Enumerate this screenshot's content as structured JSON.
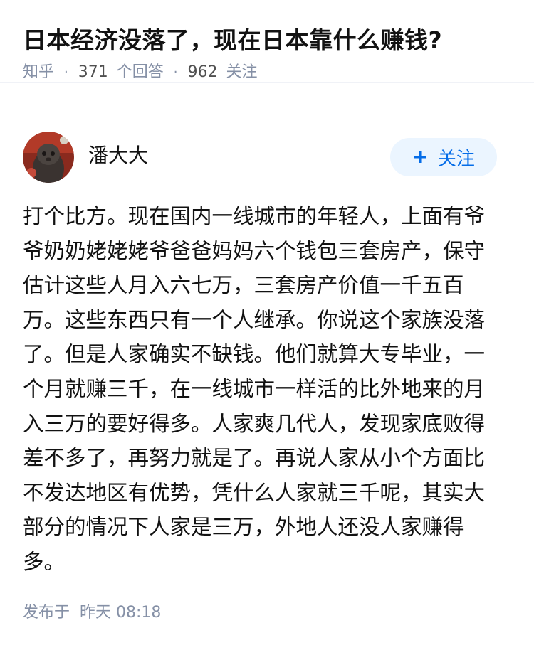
{
  "question": {
    "title": "日本经济没落了，现在日本靠什么赚钱?",
    "source": "知乎",
    "answer_count": "371",
    "answer_label": "个回答",
    "follower_count": "962",
    "follower_label": "关注"
  },
  "author": {
    "name": "潘大大",
    "avatar_icon": "avatar-photo",
    "follow_label": "关注",
    "follow_icon": "plus-icon"
  },
  "answer": {
    "content": "打个比方。现在国内一线城市的年轻人，上面有爷爷奶奶姥姥姥爷爸爸妈妈六个钱包三套房产，保守估计这些人月入六七万，三套房产价值一千五百万。这些东西只有一个人继承。你说这个家族没落了。但是人家确实不缺钱。他们就算大专毕业，一个月就赚三千，在一线城市一样活的比外地来的月入三万的要好得多。人家爽几代人，发现家底败得差不多了，再努力就是了。再说人家从小个方面比不发达地区有优势，凭什么人家就三千呢，其实大部分的情况下人家是三万，外地人还没人家赚得多。",
    "publish_prefix": "发布于",
    "publish_time": "昨天 08:18"
  },
  "colors": {
    "accent": "#056de8",
    "accent_bg": "#ebf5ff",
    "meta_gray": "#8590a6"
  }
}
